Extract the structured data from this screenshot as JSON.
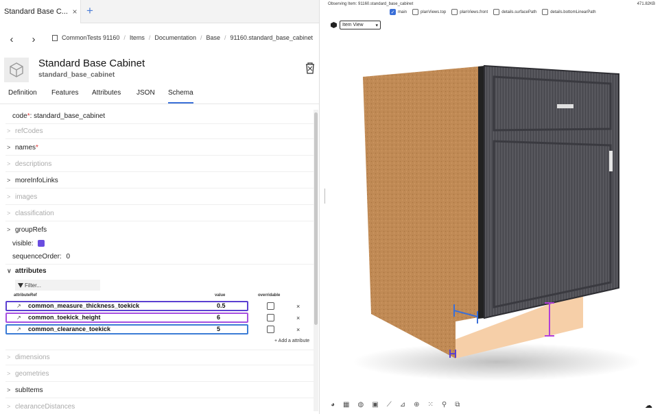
{
  "tab": {
    "label": "Standard Base C...",
    "close": "×",
    "add": "+"
  },
  "nav": {
    "back": "‹",
    "forward": "›"
  },
  "breadcrumbs": [
    "CommonTests 91160",
    "Items",
    "Documentation",
    "Base",
    "91160.standard_base_cabinet"
  ],
  "item": {
    "title": "Standard Base Cabinet",
    "subtitle": "standard_base_cabinet"
  },
  "subtabs": [
    "Definition",
    "Features",
    "Attributes",
    "JSON",
    "Schema"
  ],
  "active_subtab": "Schema",
  "schema": {
    "code_label": "code",
    "code_req": "*",
    "code_value": "standard_base_cabinet",
    "refCodes": "refCodes",
    "names": "names",
    "names_req": "*",
    "descriptions": "descriptions",
    "moreInfoLinks": "moreInfoLinks",
    "images": "images",
    "classification": "classification",
    "groupRefs": "groupRefs",
    "visible_label": "visible:",
    "sequence_label": "sequenceOrder:",
    "sequence_value": "0",
    "attributes": "attributes",
    "filter_placeholder": "Filter...",
    "col_attributeRef": "attributeRef",
    "col_value": "value",
    "col_overridable": "overridable",
    "rows": [
      {
        "name": "common_measure_thickness_toekick",
        "value": "0.5",
        "color": "#5b3fd1"
      },
      {
        "name": "common_toekick_height",
        "value": "6",
        "color": "#a64fe0"
      },
      {
        "name": "common_clearance_toekick",
        "value": "5",
        "color": "#3a7bd5"
      }
    ],
    "remove": "×",
    "add_attribute": "+ Add a attribute",
    "dimensions": "dimensions",
    "geometries": "geometries",
    "subItems": "subItems",
    "clearanceDistances": "clearanceDistances"
  },
  "viewer": {
    "observing": "Observing Item: 91160.standard_base_cabinet",
    "filesize": "471.82KB",
    "views": [
      {
        "label": "main",
        "checked": true
      },
      {
        "label": "planViews.top",
        "checked": false
      },
      {
        "label": "planViews.front",
        "checked": false
      },
      {
        "label": "details.surfacePath",
        "checked": false
      },
      {
        "label": "details.bottomLinearPath",
        "checked": false
      }
    ],
    "view_select": "Item View"
  },
  "colors": {
    "accent": "#3a6fd8",
    "purple": "#6a4de0",
    "wood": "#c08a55",
    "door": "#4d4d52",
    "toekick": "#f6cfa8"
  }
}
